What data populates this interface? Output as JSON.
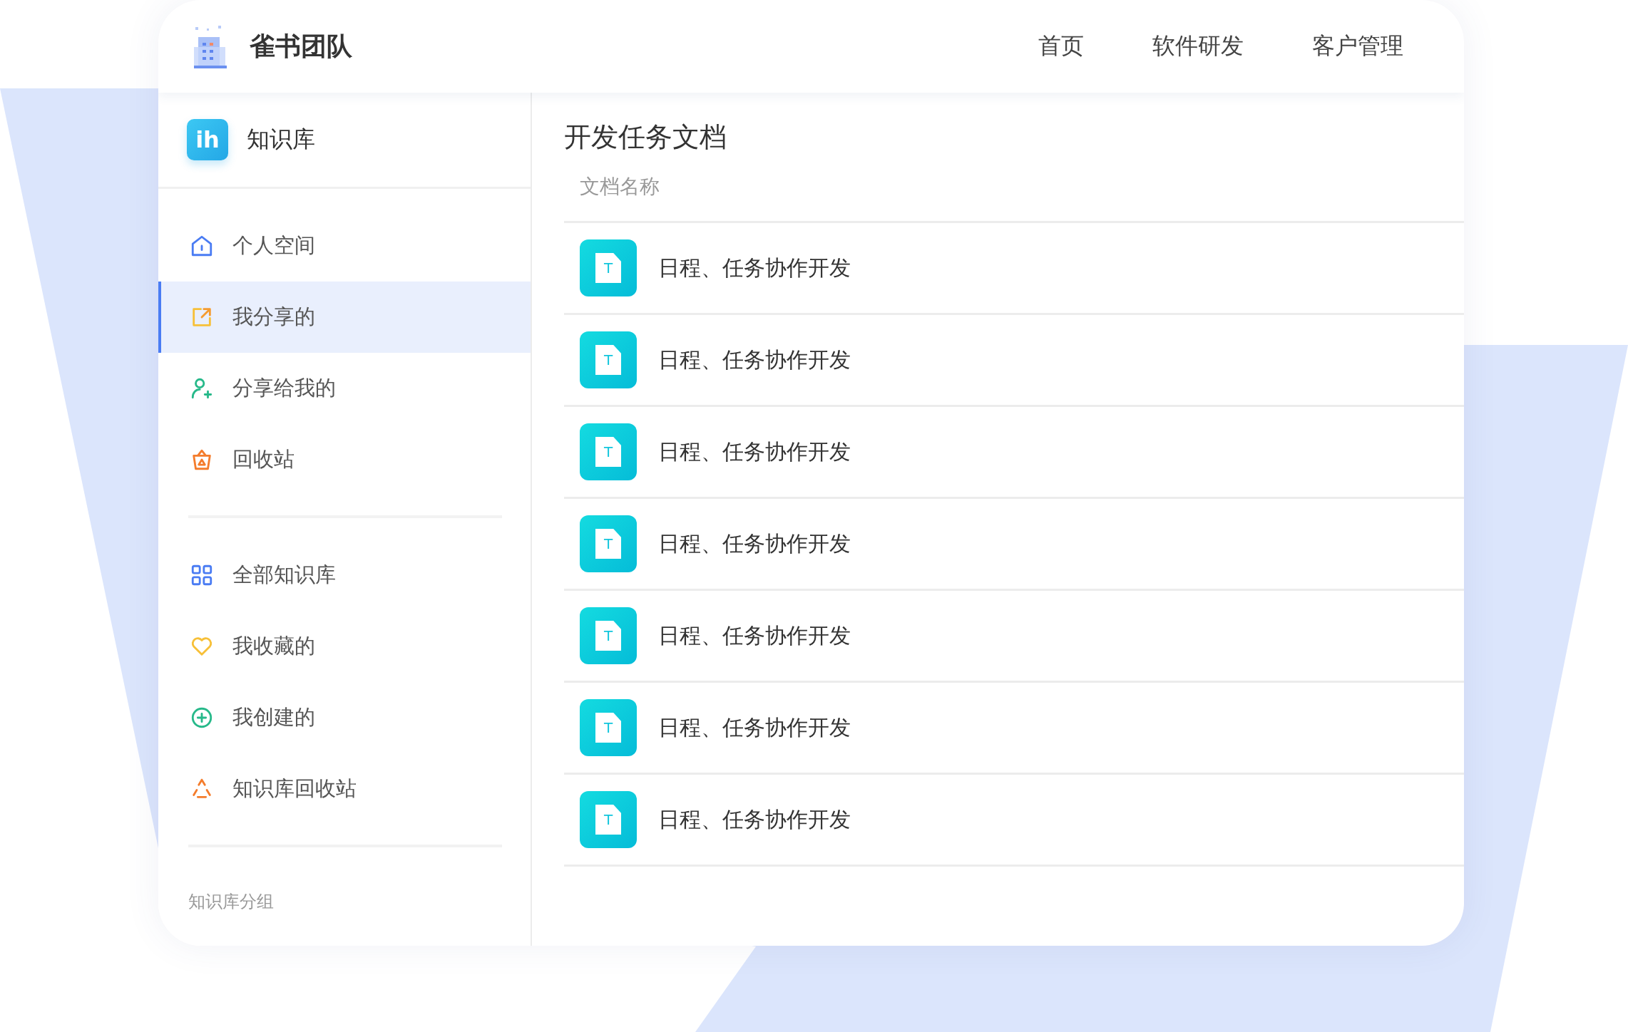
{
  "header": {
    "brand": "雀书团队",
    "nav": [
      {
        "label": "首页"
      },
      {
        "label": "软件研发"
      },
      {
        "label": "客户管理"
      }
    ]
  },
  "sidebar": {
    "app_icon_text": "ih",
    "title": "知识库",
    "groups": [
      {
        "items": [
          {
            "label": "个人空间",
            "selected": false
          },
          {
            "label": "我分享的",
            "selected": true
          },
          {
            "label": "分享给我的",
            "selected": false
          },
          {
            "label": "回收站",
            "selected": false
          }
        ]
      },
      {
        "items": [
          {
            "label": "全部知识库",
            "selected": false
          },
          {
            "label": "我收藏的",
            "selected": false
          },
          {
            "label": "我创建的",
            "selected": false
          },
          {
            "label": "知识库回收站",
            "selected": false
          }
        ]
      }
    ],
    "section_label": "知识库分组"
  },
  "content": {
    "title": "开发任务文档",
    "column": "文档名称",
    "rows": [
      {
        "icon_letter": "T",
        "name": "日程、任务协作开发"
      },
      {
        "icon_letter": "T",
        "name": "日程、任务协作开发"
      },
      {
        "icon_letter": "T",
        "name": "日程、任务协作开发"
      },
      {
        "icon_letter": "T",
        "name": "日程、任务协作开发"
      },
      {
        "icon_letter": "T",
        "name": "日程、任务协作开发"
      },
      {
        "icon_letter": "T",
        "name": "日程、任务协作开发"
      },
      {
        "icon_letter": "T",
        "name": "日程、任务协作开发"
      }
    ]
  }
}
